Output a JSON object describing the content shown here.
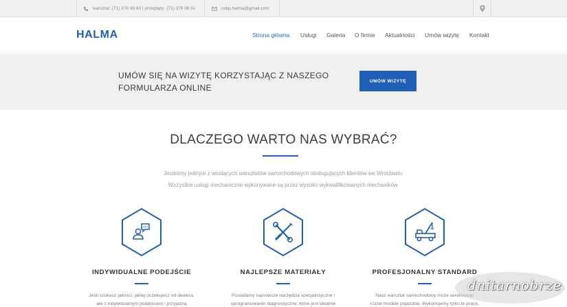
{
  "topbar": {
    "phone": "warsztat: (71) 376 96 60 | przeglądy: (71) 376 96 61",
    "email": "oskp.halma@gmail.com"
  },
  "header": {
    "logo": "HALMA",
    "nav": [
      {
        "label": "Strona główna",
        "active": true
      },
      {
        "label": "Usługi"
      },
      {
        "label": "Galeria"
      },
      {
        "label": "O firmie"
      },
      {
        "label": "Aktualności"
      },
      {
        "label": "Umów wizytę"
      },
      {
        "label": "Kontakt"
      }
    ]
  },
  "cta": {
    "line1": "UMÓW SIĘ NA WIZYTĘ KORZYSTAJĄC Z NASZEGO",
    "line2": "FORMULARZA ONLINE",
    "button": "UMÓW WIZYTĘ"
  },
  "main": {
    "heading": "DLACZEGO WARTO NAS WYBRAĆ?",
    "intro1": "Jesteśmy jednym z wiodących warsztatów samochodowych obsługujących klientów we Wrocławiu.",
    "intro2": "Wszystkie usługi mechaniczne wykonywane są przez wysoko wykwalifikowanych mechaników."
  },
  "features": [
    {
      "title": "INDYWIDUALNE PODEJŚCIE",
      "icon": "customer-chat-icon",
      "text1": "Jeśli szukasz jakości, jakiej oczekujesz od dealera,",
      "text2": "ale z indywidualnym podejściem i przyjazną"
    },
    {
      "title": "NAJLEPSZE MATERIAŁY",
      "icon": "wrench-screwdriver-icon",
      "text1": "Posiadamy najnowsze narzędzia specjalistyczne i",
      "text2": "oprogramowanie diagnostyczne, które jest idealnie"
    },
    {
      "title": "PROFESJONALNY STANDARD",
      "icon": "tow-truck-icon",
      "text1": "Nasz warsztat samochodowy może serwisować",
      "text2": "różne modele pojazdów. Wykonujemy tylko te prace,"
    }
  ],
  "watermark": "dnitarnobrze",
  "colors": {
    "accent": "#1f5fb5",
    "cta_band": "#f0f0f0",
    "topbar": "#f1f1f1"
  }
}
